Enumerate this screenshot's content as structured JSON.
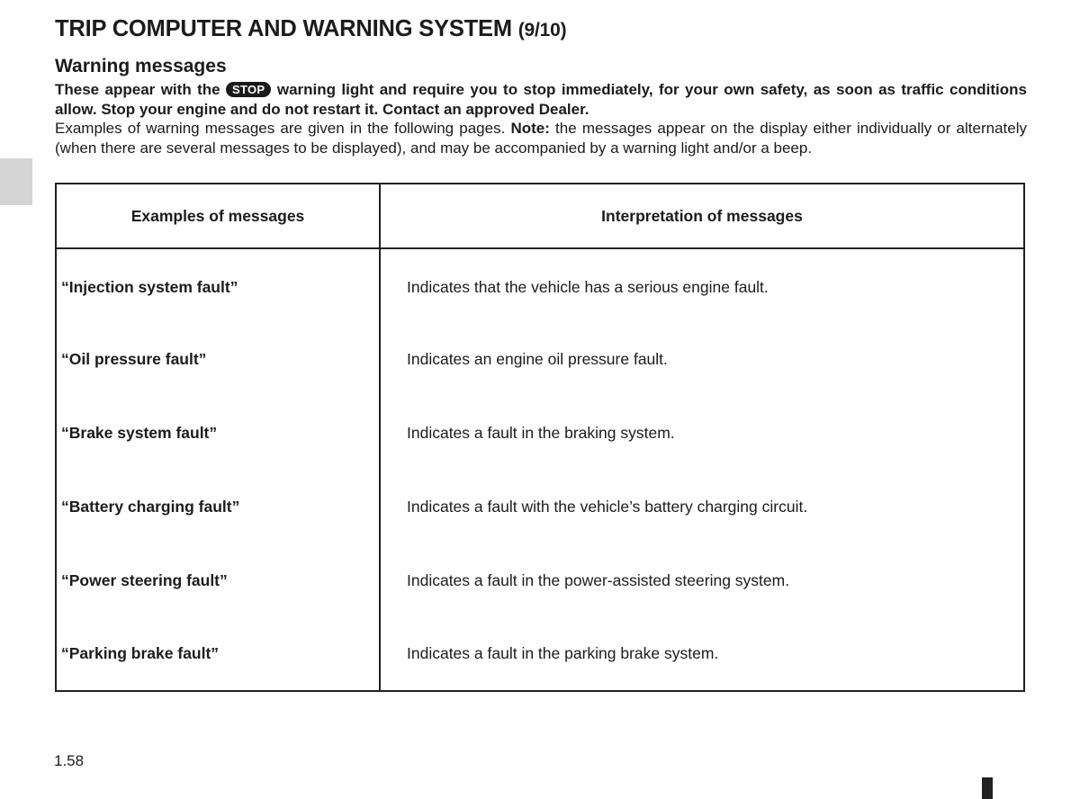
{
  "header": {
    "title": "TRIP COMPUTER AND WARNING SYSTEM",
    "part": "(9/10)"
  },
  "section": {
    "subtitle": "Warning messages",
    "intro_bold_before_badge": "These appear with the",
    "stop_badge": "STOP",
    "intro_bold_after_badge": "warning light and require you to stop immediately, for your own safety, as soon as traffic conditions allow. Stop your engine and do not restart it. Contact an approved Dealer.",
    "intro_plain": "Examples of warning messages are given in the following pages.",
    "note_label": "Note:",
    "note_text": "the messages appear on the display either individually or alternately (when there are several messages to be displayed), and may be accompanied by a warning light and/or a beep."
  },
  "table": {
    "headers": [
      "Examples of messages",
      "Interpretation of messages"
    ],
    "rows": [
      {
        "message": "“Injection system fault”",
        "interpretation": "Indicates that the vehicle has a serious engine fault."
      },
      {
        "message": "“Oil pressure fault”",
        "interpretation": "Indicates an engine oil pressure fault."
      },
      {
        "message": "“Brake system fault”",
        "interpretation": "Indicates a fault in the braking system."
      },
      {
        "message": "“Battery charging fault”",
        "interpretation": "Indicates a fault with the vehicle’s battery charging circuit."
      },
      {
        "message": "“Power steering fault”",
        "interpretation": "Indicates a fault in the power-assisted steering system."
      },
      {
        "message": "“Parking brake fault”",
        "interpretation": "Indicates a fault in the parking brake system."
      }
    ]
  },
  "footer": {
    "page_number": "1.58"
  }
}
